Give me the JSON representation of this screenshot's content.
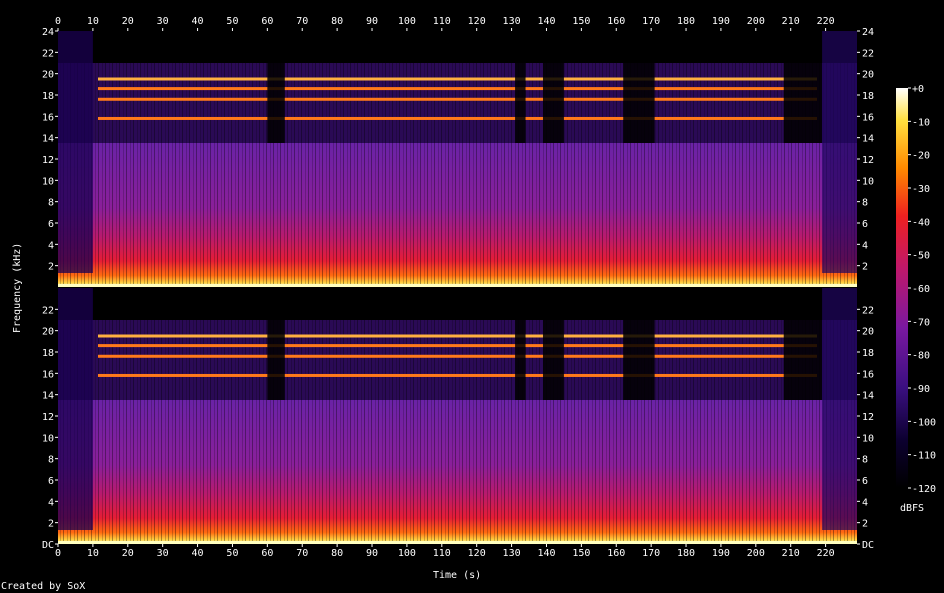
{
  "chart_data": {
    "type": "heatmap",
    "subtype": "spectrogram",
    "title": "",
    "xlabel": "Time (s)",
    "ylabel": "Frequency (kHz)",
    "xlim": [
      0,
      229
    ],
    "ylim": [
      0,
      24
    ],
    "x_ticks": [
      "0",
      "10",
      "20",
      "30",
      "40",
      "50",
      "60",
      "70",
      "80",
      "90",
      "100",
      "110",
      "120",
      "130",
      "140",
      "150",
      "160",
      "170",
      "180",
      "190",
      "200",
      "210",
      "220"
    ],
    "y_ticks_upper": [
      "2",
      "4",
      "6",
      "8",
      "10",
      "12",
      "14",
      "16",
      "18",
      "20",
      "22",
      "24"
    ],
    "y_ticks_lower": [
      "DC",
      "2",
      "4",
      "6",
      "8",
      "10",
      "12",
      "14",
      "16",
      "18",
      "20",
      "22"
    ],
    "channels": 2,
    "colorbar": {
      "label": "dBFS",
      "ticks": [
        "+0",
        "-10",
        "-20",
        "-30",
        "-40",
        "-50",
        "-60",
        "-70",
        "-80",
        "-90",
        "-100",
        "-110",
        "-120"
      ],
      "range": [
        -120,
        0
      ]
    },
    "colors": [
      "#000000",
      "#1a0050",
      "#5a16a0",
      "#a01880",
      "#e81e1e",
      "#ff9a00",
      "#ffff8c",
      "#ffffff"
    ],
    "hf_band_kHz": [
      13.5,
      21
    ],
    "tone_lines_kHz": [
      15.8,
      17.6,
      18.6,
      19.5
    ],
    "gaps_s": [
      [
        60,
        65
      ],
      [
        131,
        134
      ],
      [
        139,
        145
      ],
      [
        162,
        171
      ],
      [
        208,
        219
      ]
    ],
    "grid": false,
    "legend": "colorbar-right"
  },
  "footer": {
    "credit": "Created by SoX"
  }
}
